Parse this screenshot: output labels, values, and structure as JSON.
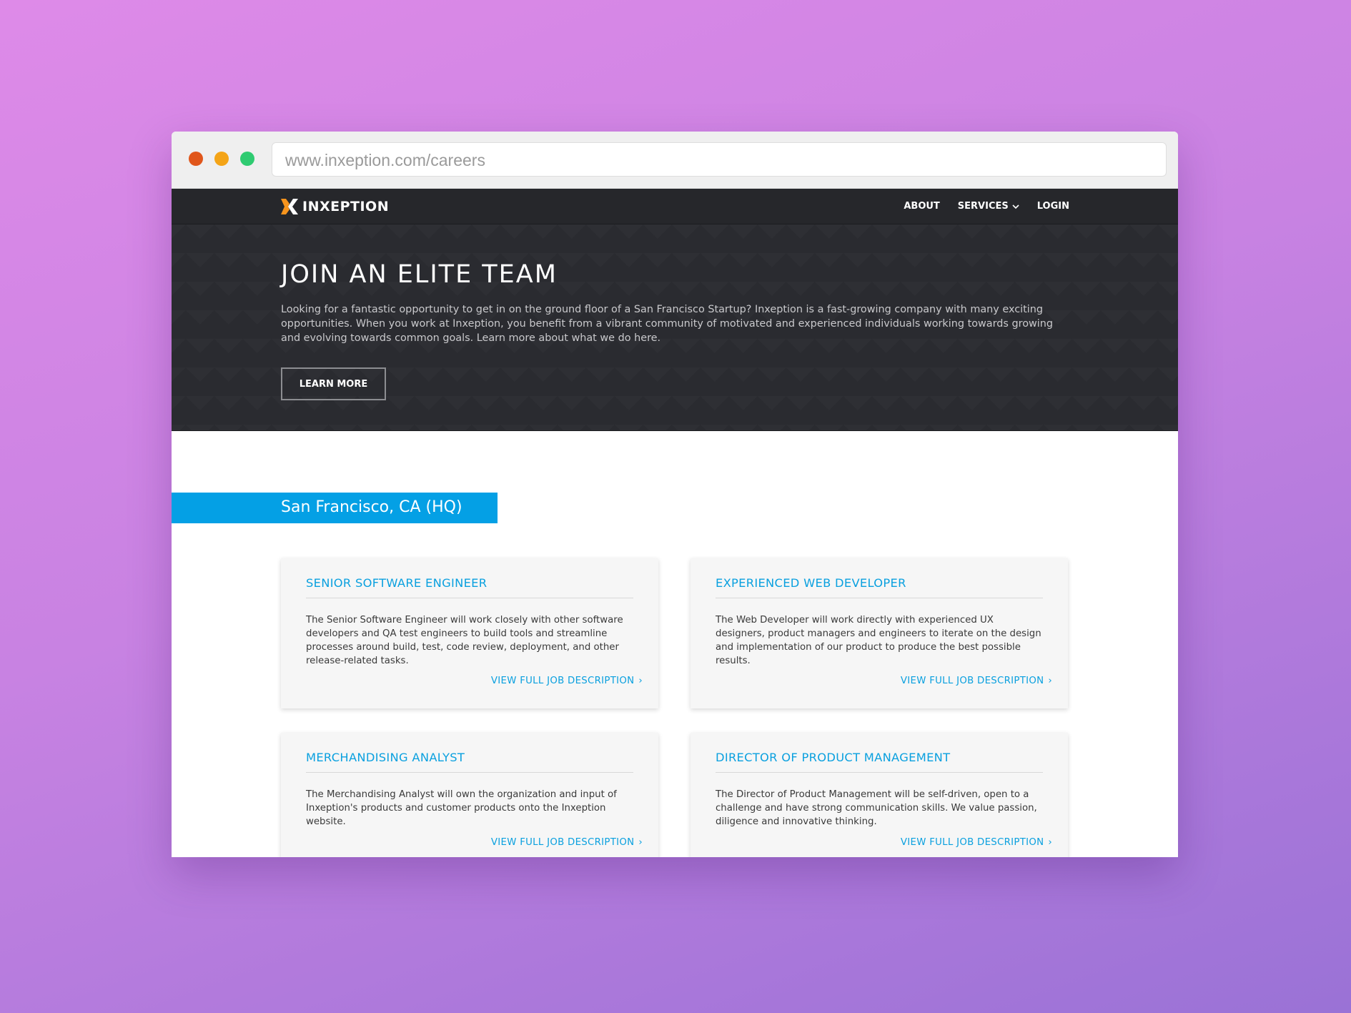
{
  "browser": {
    "url": "www.inxeption.com/careers",
    "colors": {
      "close": "#e0561b",
      "minimize": "#f4a417",
      "maximize": "#2fcb71"
    }
  },
  "nav": {
    "brand": "INXEPTION",
    "items": [
      {
        "label": "ABOUT"
      },
      {
        "label": "SERVICES",
        "icon": "chevron-down-icon"
      },
      {
        "label": "LOGIN"
      }
    ]
  },
  "hero": {
    "title": "JOIN AN ELITE TEAM",
    "text": "Looking for a fantastic opportunity to get in on the ground floor of a San Francisco Startup? Inxeption is a fast-growing company with many exciting opportunities. When you work at Inxeption, you benefit from a vibrant community of motivated and experienced individuals working towards growing and evolving towards common goals. Learn more about what we do here.",
    "button": "LEARN MORE"
  },
  "location": "San Francisco, CA (HQ)",
  "jobs": [
    {
      "title": "SENIOR SOFTWARE ENGINEER",
      "description": "The Senior Software Engineer will work closely with other software developers and QA test engineers to build tools and streamline processes around build, test, code review, deployment, and other release-related tasks.",
      "link": "VIEW FULL JOB DESCRIPTION"
    },
    {
      "title": "EXPERIENCED WEB DEVELOPER",
      "description": "The Web Developer will work directly with experienced UX designers, product managers and engineers to iterate on the design and implementation of our product to produce the best possible results.",
      "link": "VIEW FULL JOB DESCRIPTION"
    },
    {
      "title": "MERCHANDISING ANALYST",
      "description": "The Merchandising Analyst will own the organization and input of Inxeption's products and customer products onto the Inxeption website.",
      "link": "VIEW FULL JOB DESCRIPTION"
    },
    {
      "title": "DIRECTOR OF PRODUCT MANAGEMENT",
      "description": "The Director of Product Management will be self-driven, open to a challenge and have strong communication skills. We value passion, diligence and innovative thinking.",
      "link": "VIEW FULL JOB DESCRIPTION"
    }
  ],
  "colors": {
    "accent": "#04a0e5",
    "brand_mark": "#f7941d",
    "nav_bg": "#26272b"
  }
}
